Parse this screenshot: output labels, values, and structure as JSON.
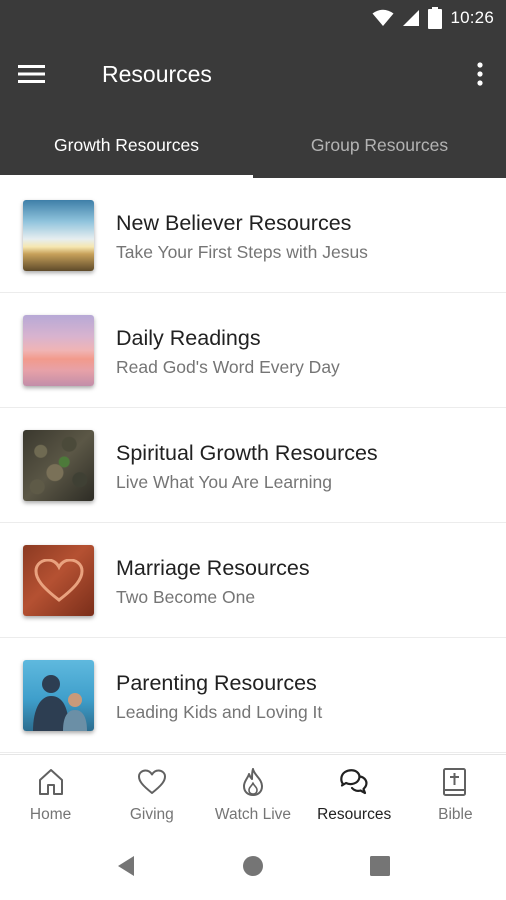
{
  "status_bar": {
    "time": "10:26",
    "icons": [
      "wifi-icon",
      "signal-icon",
      "battery-icon"
    ]
  },
  "app_bar": {
    "title": "Resources",
    "menu_icon": "hamburger-menu-icon",
    "overflow_icon": "more-vert-icon"
  },
  "tabs": [
    {
      "label": "Growth Resources",
      "active": true
    },
    {
      "label": "Group Resources",
      "active": false
    }
  ],
  "resources": [
    {
      "title": "New Believer Resources",
      "subtitle": "Take Your First Steps with Jesus",
      "thumbnail": "sunrise-field-image"
    },
    {
      "title": "Daily Readings",
      "subtitle": "Read God's Word Every Day",
      "thumbnail": "pink-sunset-image"
    },
    {
      "title": "Spiritual Growth Resources",
      "subtitle": "Live What You Are Learning",
      "thumbnail": "sprout-in-leaves-image"
    },
    {
      "title": "Marriage Resources",
      "subtitle": "Two Become One",
      "thumbnail": "hands-heart-image"
    },
    {
      "title": "Parenting Resources",
      "subtitle": "Leading Kids and Loving It",
      "thumbnail": "parent-child-image"
    }
  ],
  "bottom_nav": [
    {
      "label": "Home",
      "icon": "home-icon",
      "active": false
    },
    {
      "label": "Giving",
      "icon": "heart-icon",
      "active": false
    },
    {
      "label": "Watch Live",
      "icon": "flame-icon",
      "active": false
    },
    {
      "label": "Resources",
      "icon": "chat-bubbles-icon",
      "active": true
    },
    {
      "label": "Bible",
      "icon": "bible-icon",
      "active": false
    }
  ],
  "system_nav": [
    "back-icon",
    "home-circle-icon",
    "recents-icon"
  ],
  "colors": {
    "header": "#3a3a3a",
    "active_tab_text": "#ffffff",
    "inactive_tab_text": "#b3b3b3",
    "title_text": "#212121",
    "subtitle_text": "#757575"
  }
}
